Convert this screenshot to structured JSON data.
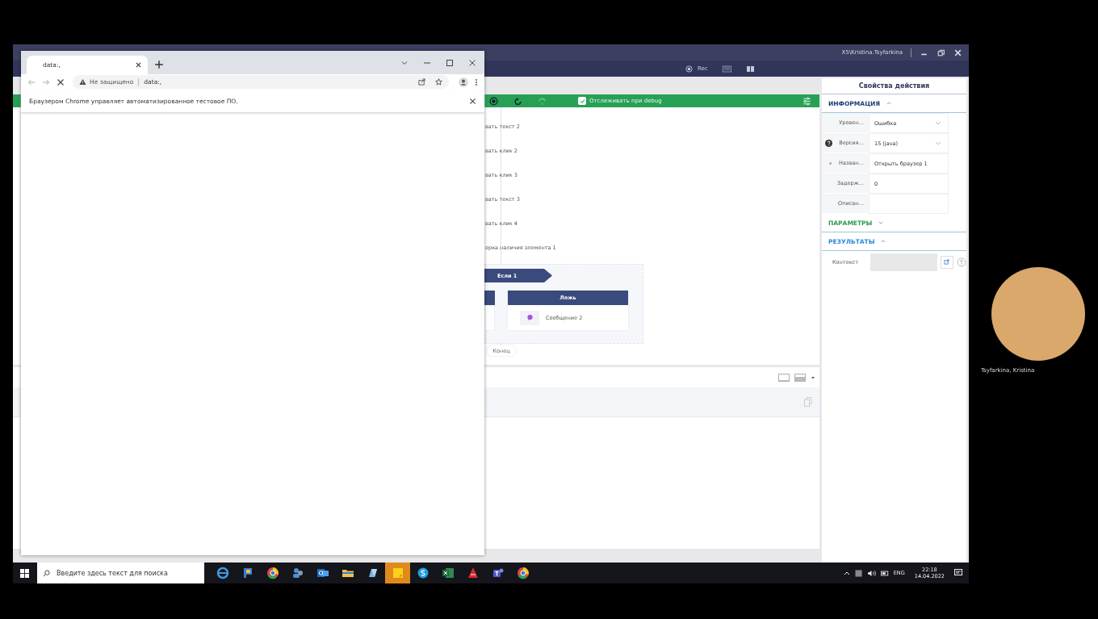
{
  "app": {
    "account": "X5\\Kristina.Tsyfarkina",
    "rec_label": "Rec"
  },
  "debug_bar": {
    "track_label": "Отслеживать при debug",
    "track_checked": true
  },
  "flow": {
    "steps": [
      {
        "title": "вать текст 2"
      },
      {
        "title": "вать клик 2"
      },
      {
        "title": "вать клик 3"
      },
      {
        "title": "вать текст 3"
      },
      {
        "title": "вать клик 4"
      },
      {
        "title": "ерка наличия элемента 1"
      }
    ],
    "condition": "Если 1",
    "branch": "Ложь",
    "message": "Сообщение 2",
    "end": "Конец"
  },
  "properties": {
    "title": "Свойства действия",
    "sections": [
      {
        "title": "ИНФОРМАЦИЯ",
        "expanded": true,
        "color": "#1f3a78",
        "fields": [
          {
            "label": "Уровен…",
            "value": "Ошибка",
            "kind": "dropdown",
            "help": false,
            "required": false
          },
          {
            "label": "Версия…",
            "value": "15 (java)",
            "kind": "dropdown",
            "help": true,
            "required": false
          },
          {
            "label": "Назван…",
            "value": "Открыть браузер 1",
            "kind": "text",
            "help": false,
            "required": true
          },
          {
            "label": "Задерж…",
            "value": "0",
            "kind": "text",
            "help": false,
            "required": false
          },
          {
            "label": "Описан…",
            "kind": "text",
            "help": false,
            "required": false
          }
        ]
      },
      {
        "title": "ПАРАМЕТРЫ",
        "expanded": false,
        "color": "#2b9a52"
      },
      {
        "title": "РЕЗУЛЬТАТЫ",
        "expanded": true,
        "color": "#2a8ad4",
        "fields": [
          {
            "label": "Контекст",
            "kind": "context"
          }
        ]
      }
    ]
  },
  "browser": {
    "tab_title": "data:,",
    "security": "Не защищено",
    "url": "data:,",
    "infobar": "Браузером Chrome управляет автоматизированное тестовое ПО."
  },
  "taskbar": {
    "search_placeholder": "Введите здесь текст для поиска",
    "language": "ENG",
    "time": "22:18",
    "date": "14.04.2022"
  },
  "participant": {
    "name": "Tsyfarkina, Kristina"
  }
}
